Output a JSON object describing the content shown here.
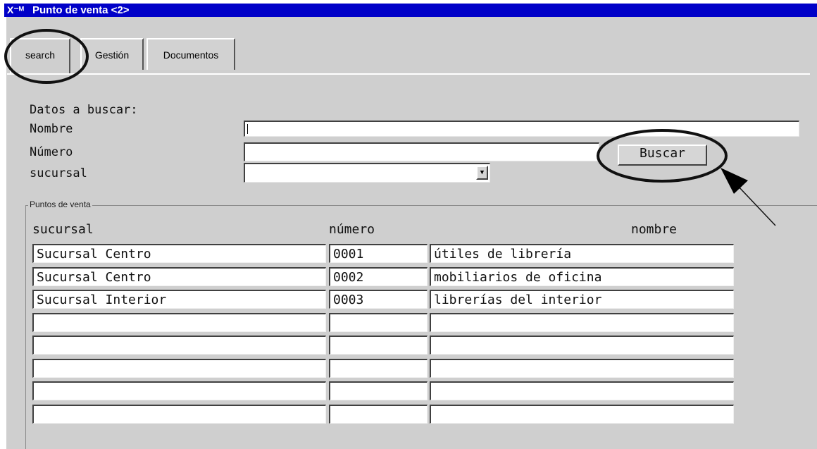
{
  "window": {
    "title": "Punto de venta <2>",
    "icon_glyph": "X⁻ᴹ",
    "colors": {
      "titlebar": "#0000c8",
      "window_bg": "#cfcfcf"
    }
  },
  "tabs": [
    {
      "label": "search",
      "active": true
    },
    {
      "label": "Gestión",
      "active": false
    },
    {
      "label": "Documentos",
      "active": false
    }
  ],
  "form": {
    "heading": "Datos a buscar:",
    "nombre_label": "Nombre",
    "nombre_value": "",
    "numero_label": "Número",
    "numero_value": "",
    "sucursal_label": "sucursal",
    "sucursal_value": "",
    "buscar_label": "Buscar"
  },
  "group": {
    "title": "Puntos de venta",
    "headers": {
      "sucursal": "sucursal",
      "numero": "número",
      "nombre": "nombre"
    },
    "rows": [
      {
        "sucursal": "Sucursal Centro",
        "numero": "0001",
        "nombre": "útiles de librería"
      },
      {
        "sucursal": "Sucursal Centro",
        "numero": "0002",
        "nombre": "mobiliarios de oficina"
      },
      {
        "sucursal": "Sucursal Interior",
        "numero": "0003",
        "nombre": "librerías del interior"
      },
      {
        "sucursal": "",
        "numero": "",
        "nombre": ""
      },
      {
        "sucursal": "",
        "numero": "",
        "nombre": ""
      },
      {
        "sucursal": "",
        "numero": "",
        "nombre": ""
      },
      {
        "sucursal": "",
        "numero": "",
        "nombre": ""
      },
      {
        "sucursal": "",
        "numero": "",
        "nombre": ""
      }
    ]
  }
}
